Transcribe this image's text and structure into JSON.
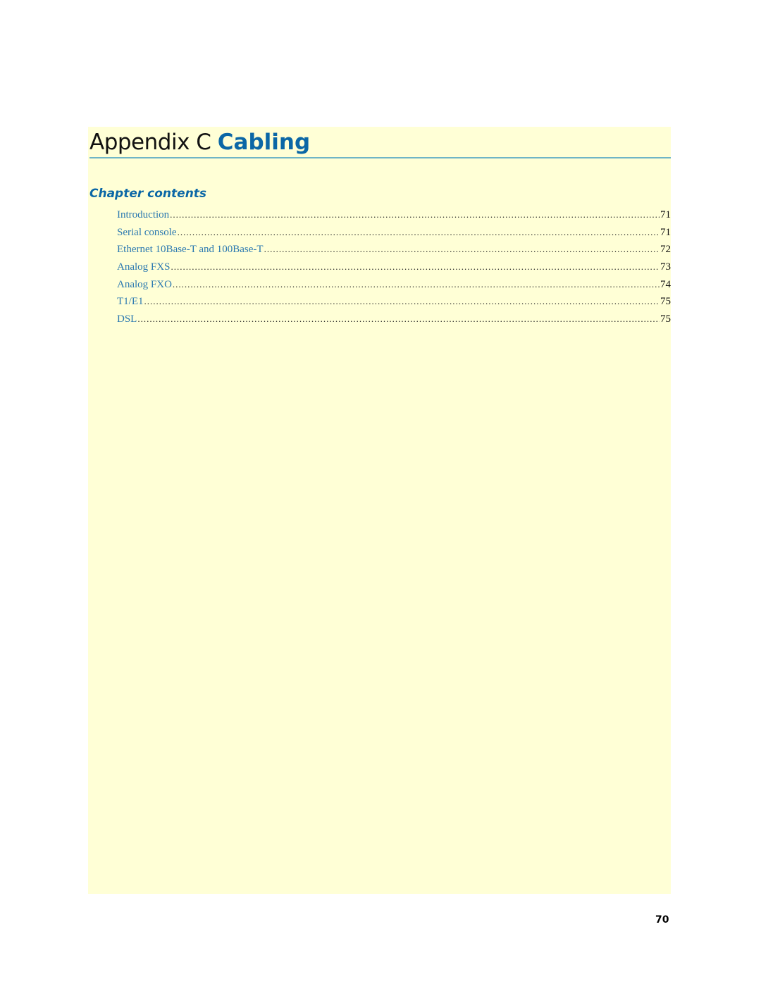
{
  "header": {
    "prefix": "Appendix C",
    "title": "Cabling"
  },
  "chapter_contents": {
    "heading": "Chapter contents",
    "items": [
      {
        "label": "Introduction",
        "page": "71"
      },
      {
        "label": "Serial console",
        "page": "71"
      },
      {
        "label": "Ethernet 10Base-T and 100Base-T",
        "page": "72"
      },
      {
        "label": "Analog FXS",
        "page": "73"
      },
      {
        "label": "Analog FXO",
        "page": "74"
      },
      {
        "label": "T1/E1",
        "page": "75"
      },
      {
        "label": "DSL",
        "page": "75"
      }
    ]
  },
  "footer": {
    "page_number": "70"
  },
  "colors": {
    "accent": "#0b67a6",
    "panel_background": "#ffffd6",
    "rule": "#6fb5c6"
  }
}
